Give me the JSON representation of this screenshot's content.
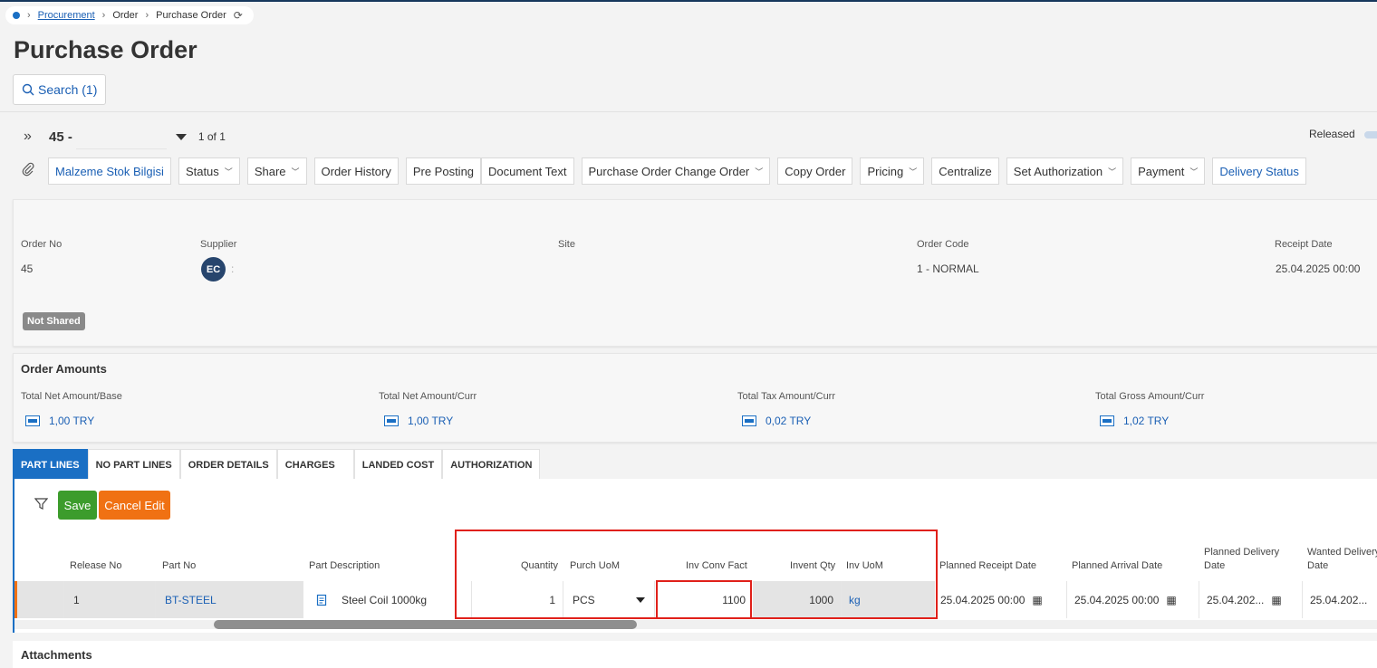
{
  "breadcrumb": {
    "items": [
      "Procurement",
      "Order",
      "Purchase Order"
    ]
  },
  "page_title": "Purchase Order",
  "search": {
    "label": "Search (1)"
  },
  "record": {
    "id": "45 -",
    "position": "1 of 1",
    "status": "Released"
  },
  "toolbar": {
    "items": [
      "Malzeme Stok Bilgisi",
      "Status",
      "Share",
      "Order History",
      "Pre Posting",
      "Document Text",
      "Purchase Order Change Order",
      "Copy Order",
      "Pricing",
      "Centralize",
      "Set Authorization",
      "Payment",
      "Delivery Status"
    ]
  },
  "header": {
    "order_no_label": "Order No",
    "order_no": "45",
    "supplier_label": "Supplier",
    "supplier_initials": "EC",
    "supplier_suffix": ":",
    "site_label": "Site",
    "order_code_label": "Order Code",
    "order_code": "1 - NORMAL",
    "receipt_date_label": "Receipt Date",
    "receipt_date": "25.04.2025 00:00",
    "share_badge": "Not Shared"
  },
  "amounts": {
    "title": "Order Amounts",
    "total_net_base_label": "Total Net Amount/Base",
    "total_net_base": "1,00 TRY",
    "total_net_curr_label": "Total Net Amount/Curr",
    "total_net_curr": "1,00 TRY",
    "total_tax_curr_label": "Total Tax Amount/Curr",
    "total_tax_curr": "0,02 TRY",
    "total_gross_curr_label": "Total Gross Amount/Curr",
    "total_gross_curr": "1,02 TRY"
  },
  "tabs": [
    "PART LINES",
    "NO PART LINES",
    "ORDER DETAILS",
    "CHARGES",
    "LANDED COST",
    "AUTHORIZATION"
  ],
  "grid": {
    "save": "Save",
    "cancel": "Cancel Edit",
    "columns": {
      "release_no": "Release No",
      "part_no": "Part No",
      "part_desc": "Part Description",
      "quantity": "Quantity",
      "purch_uom": "Purch UoM",
      "inv_conv_fact": "Inv Conv Fact",
      "invent_qty": "Invent Qty",
      "inv_uom": "Inv UoM",
      "planned_receipt": "Planned Receipt Date",
      "planned_arrival": "Planned Arrival Date",
      "planned_delivery": "Planned Delivery Date",
      "wanted_delivery": "Wanted Delivery Date"
    },
    "row": {
      "release_no": "1",
      "part_no": "BT-STEEL",
      "part_desc": "Steel Coil 1000kg",
      "quantity": "1",
      "purch_uom": "PCS",
      "inv_conv_fact": "1100",
      "invent_qty": "1000",
      "inv_uom": "kg",
      "planned_receipt": "25.04.2025 00:00",
      "planned_arrival": "25.04.2025 00:00",
      "planned_delivery": "25.04.202...",
      "wanted_delivery": "25.04.202..."
    }
  },
  "attachments": {
    "title": "Attachments"
  }
}
